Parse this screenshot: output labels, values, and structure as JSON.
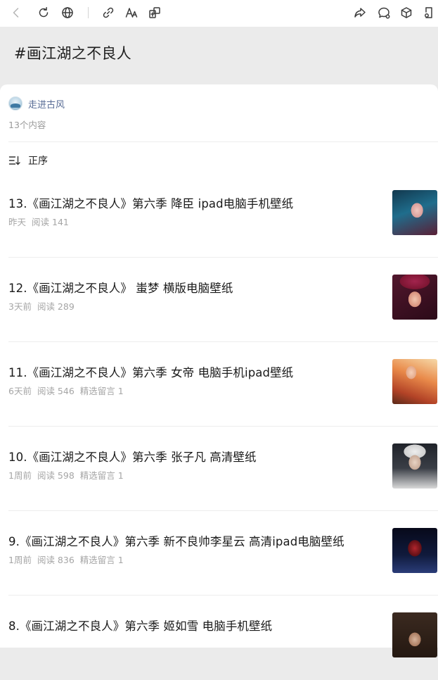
{
  "toolbar": {
    "left_icons": [
      "back-icon",
      "refresh-icon",
      "globe-icon"
    ],
    "mid_icons": [
      "link-icon",
      "font-size-icon",
      "translate-icon"
    ],
    "right_icons": [
      "share-icon",
      "comment-icon",
      "cube-icon",
      "bookmark-icon"
    ]
  },
  "header": {
    "title": "#画江湖之不良人"
  },
  "author": {
    "name": "走进古风",
    "count": "13个内容"
  },
  "sort": {
    "label": "正序"
  },
  "articles": [
    {
      "title": "13.《画江湖之不良人》第六季 降臣 ipad电脑手机壁纸",
      "time": "昨天",
      "reads": "阅读 141",
      "comments": ""
    },
    {
      "title": "12.《画江湖之不良人》 蚩梦 横版电脑壁纸",
      "time": "3天前",
      "reads": "阅读 289",
      "comments": ""
    },
    {
      "title": "11.《画江湖之不良人》第六季 女帝 电脑手机ipad壁纸",
      "time": "6天前",
      "reads": "阅读 546",
      "comments": "精选留言 1"
    },
    {
      "title": "10.《画江湖之不良人》第六季 张子凡 高清壁纸",
      "time": "1周前",
      "reads": "阅读 598",
      "comments": "精选留言 1"
    },
    {
      "title": "9.《画江湖之不良人》第六季 新不良帅李星云 高清ipad电脑壁纸",
      "time": "1周前",
      "reads": "阅读 836",
      "comments": "精选留言 1"
    },
    {
      "title": "8.《画江湖之不良人》第六季 姬如雪 电脑手机壁纸",
      "time": "",
      "reads": "",
      "comments": ""
    }
  ],
  "colors": {
    "link": "#576b95",
    "meta": "#a5a5a5",
    "hero_bg": "#ebebeb"
  }
}
